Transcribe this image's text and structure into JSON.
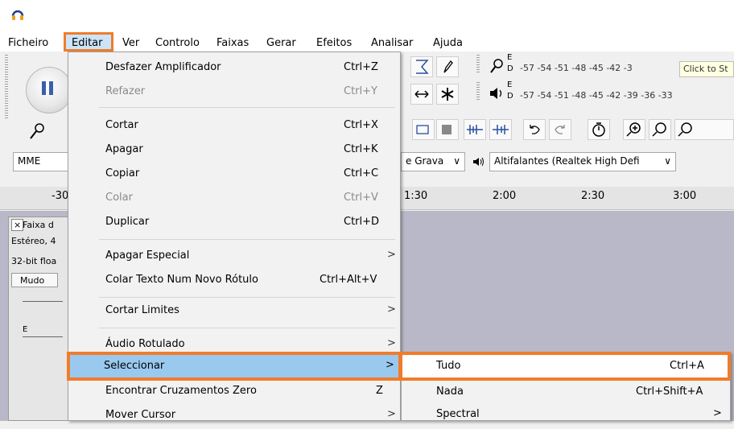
{
  "menubar": {
    "items": [
      "Ficheiro",
      "Editar",
      "Ver",
      "Controlo",
      "Faixas",
      "Gerar",
      "Efeitos",
      "Analisar",
      "Ajuda"
    ]
  },
  "toolbar": {
    "meter_rec_scale": "-57 -54 -51 -48 -45 -42 -3",
    "meter_rec_hint": "Click to St",
    "meter_play_scale": "-57 -54 -51 -48 -45 -42 -39 -36 -33",
    "meter_letters_top": "E",
    "meter_letters_bottom": "D",
    "host_combo": "MME",
    "rec_device_combo": "e Grava",
    "play_device_combo": "Altifalantes (Realtek High Defi"
  },
  "ruler": {
    "left_label": "-30",
    "ticks": [
      "1:30",
      "2:00",
      "2:30",
      "3:00"
    ]
  },
  "track": {
    "name": "Faixa d",
    "close_glyph": "×",
    "info1": "Estéreo, 4",
    "info2": "32-bit floa",
    "mute_label": "Mudo",
    "gain_letter": "E"
  },
  "edit_menu": {
    "items": [
      {
        "label": "Desfazer Amplificador",
        "shortcut": "Ctrl+Z",
        "disabled": false
      },
      {
        "label": "Refazer",
        "shortcut": "Ctrl+Y",
        "disabled": true
      },
      {
        "label": "Cortar",
        "shortcut": "Ctrl+X",
        "disabled": false
      },
      {
        "label": "Apagar",
        "shortcut": "Ctrl+K",
        "disabled": false
      },
      {
        "label": "Copiar",
        "shortcut": "Ctrl+C",
        "disabled": false
      },
      {
        "label": "Colar",
        "shortcut": "Ctrl+V",
        "disabled": true
      },
      {
        "label": "Duplicar",
        "shortcut": "Ctrl+D",
        "disabled": false
      },
      {
        "label": "Apagar Especial",
        "shortcut": ">",
        "disabled": false
      },
      {
        "label": "Colar Texto Num Novo Rótulo",
        "shortcut": "Ctrl+Alt+V",
        "disabled": false
      },
      {
        "label": "Cortar Limites",
        "shortcut": ">",
        "disabled": false
      },
      {
        "label": "Áudio Rotulado",
        "shortcut": ">",
        "disabled": false
      },
      {
        "label": "Seleccionar",
        "shortcut": ">",
        "disabled": false
      },
      {
        "label": "Encontrar Cruzamentos Zero",
        "shortcut": "Z",
        "disabled": false
      },
      {
        "label": "Mover Cursor",
        "shortcut": ">",
        "disabled": false
      }
    ]
  },
  "select_submenu": {
    "items": [
      {
        "label": "Tudo",
        "shortcut": "Ctrl+A"
      },
      {
        "label": "Nada",
        "shortcut": "Ctrl+Shift+A"
      },
      {
        "label": "Spectral",
        "shortcut": ">"
      }
    ]
  },
  "colors": {
    "highlight_border": "#f07c2a",
    "menu_highlight": "#99c9ef"
  }
}
